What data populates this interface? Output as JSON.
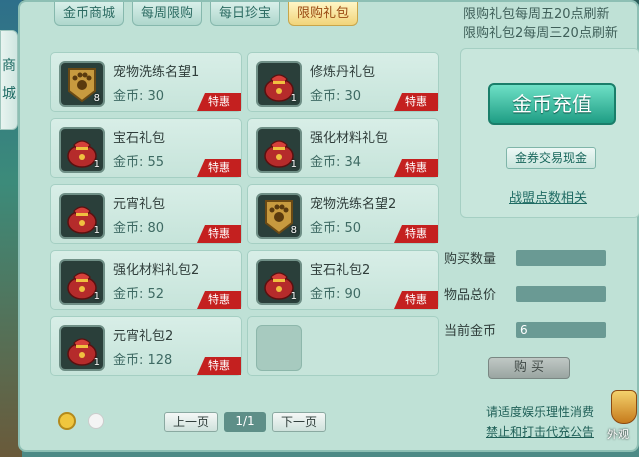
{
  "side_banner": {
    "chars": [
      "商",
      "城"
    ]
  },
  "tabs": [
    {
      "label": "金币商城",
      "active": false
    },
    {
      "label": "每周限购",
      "active": false
    },
    {
      "label": "每日珍宝",
      "active": false
    },
    {
      "label": "限购礼包",
      "active": true
    }
  ],
  "notice": {
    "line1": "限购礼包每周五20点刷新",
    "line2": "限购礼包2每周三20点刷新"
  },
  "items": [
    {
      "name": "宠物洗练名望1",
      "price": "金币: 30",
      "qty": "8",
      "badge": "特惠",
      "icon": "paw-badge-icon",
      "color": "#c79a3f"
    },
    {
      "name": "修炼丹礼包",
      "price": "金币: 30",
      "qty": "1",
      "badge": "特惠",
      "icon": "red-gift-bag-icon",
      "color": "#b52b2b"
    },
    {
      "name": "宝石礼包",
      "price": "金币: 55",
      "qty": "1",
      "badge": "特惠",
      "icon": "red-gift-bag-icon",
      "color": "#b52b2b"
    },
    {
      "name": "强化材料礼包",
      "price": "金币: 34",
      "qty": "1",
      "badge": "特惠",
      "icon": "red-gift-bag-icon",
      "color": "#b52b2b"
    },
    {
      "name": "元宵礼包",
      "price": "金币: 80",
      "qty": "1",
      "badge": "特惠",
      "icon": "red-gift-bag-icon",
      "color": "#b52b2b"
    },
    {
      "name": "宠物洗练名望2",
      "price": "金币: 50",
      "qty": "8",
      "badge": "特惠",
      "icon": "paw-badge-icon",
      "color": "#c79a3f"
    },
    {
      "name": "强化材料礼包2",
      "price": "金币: 52",
      "qty": "1",
      "badge": "特惠",
      "icon": "red-gift-bag-icon",
      "color": "#b52b2b"
    },
    {
      "name": "宝石礼包2",
      "price": "金币: 90",
      "qty": "1",
      "badge": "特惠",
      "icon": "red-gift-bag-icon",
      "color": "#b52b2b"
    },
    {
      "name": "元宵礼包2",
      "price": "金币: 128",
      "qty": "1",
      "badge": "特惠",
      "icon": "red-gift-bag-icon",
      "color": "#b52b2b"
    }
  ],
  "pager": {
    "prev": "上一页",
    "page": "1/1",
    "next": "下一页"
  },
  "right_panel": {
    "charge_button": "金币充值",
    "coupon_button": "金券交易现金",
    "guild_link": "战盟点数相关"
  },
  "form": {
    "quantity_label": "购买数量",
    "quantity_value": "",
    "total_label": "物品总价",
    "total_value": "",
    "current_gold_label": "当前金币",
    "current_gold_value": "6"
  },
  "buy_button": "购 买",
  "footer": {
    "line1": "请适度娱乐理性消费",
    "line2": "禁止和打击代充公告"
  },
  "outlook_badge": "外观"
}
